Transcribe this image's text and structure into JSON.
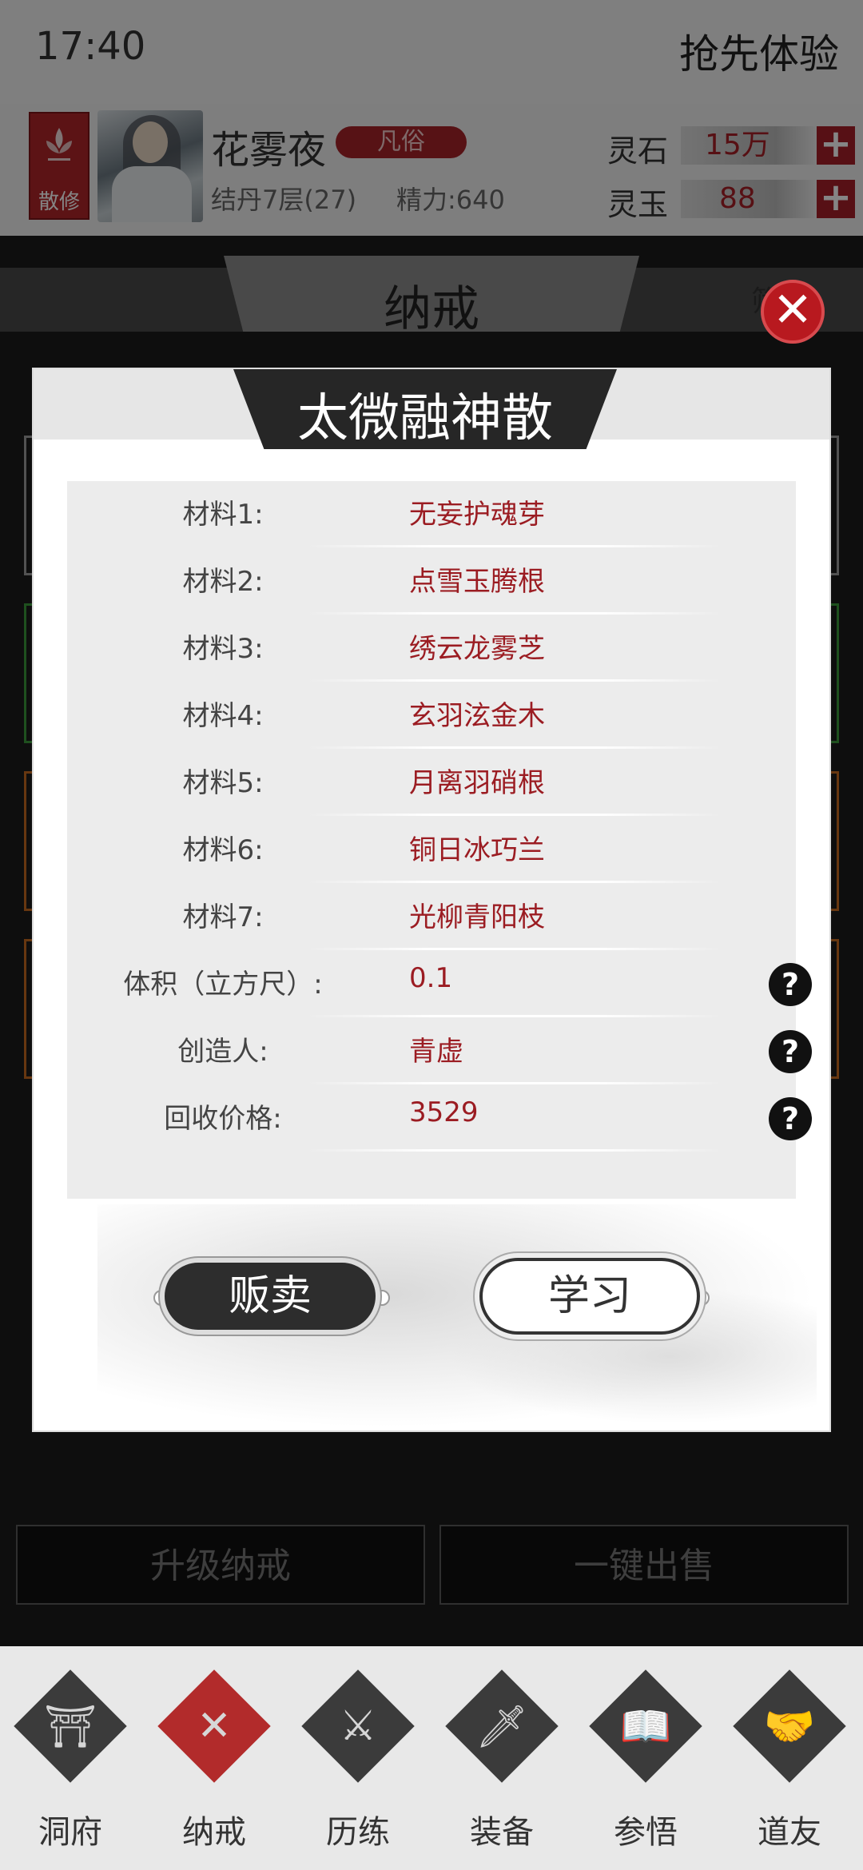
{
  "status": {
    "time": "17:40",
    "promo": "抢先体验"
  },
  "player": {
    "sect": "散修",
    "name": "花雾夜",
    "rank": "凡俗",
    "realm": "结丹7层(27)",
    "energy": "精力:640",
    "spirit_stone_label": "灵石",
    "spirit_stone_value": "15万",
    "spirit_jade_label": "灵玉",
    "spirit_jade_value": "88"
  },
  "background": {
    "tab_title": "纳戒",
    "filter": "筛",
    "upgrade_button": "升级纳戒",
    "sell_all_button": "一键出售"
  },
  "dialog": {
    "title": "太微融神散",
    "rows": [
      {
        "label": "材料1:",
        "value": "无妄护魂芽"
      },
      {
        "label": "材料2:",
        "value": "点雪玉腾根"
      },
      {
        "label": "材料3:",
        "value": "绣云龙雾芝"
      },
      {
        "label": "材料4:",
        "value": "玄羽泫金木"
      },
      {
        "label": "材料5:",
        "value": "月离羽硝根"
      },
      {
        "label": "材料6:",
        "value": "铜日冰巧兰"
      },
      {
        "label": "材料7:",
        "value": "光柳青阳枝"
      },
      {
        "label": "体积（立方尺）:",
        "value": "0.1"
      },
      {
        "label": "创造人:",
        "value": "青虚"
      },
      {
        "label": "回收价格:",
        "value": "3529"
      }
    ],
    "help_glyph": "?",
    "sell_button": "贩卖",
    "learn_button": "学习",
    "close_glyph": "✕"
  },
  "nav": [
    {
      "label": "洞府",
      "icon": "cave-gate-icon",
      "glyph": "⛩"
    },
    {
      "label": "纳戒",
      "icon": "ring-storage-icon",
      "glyph": "✕"
    },
    {
      "label": "历练",
      "icon": "crossed-swords-icon",
      "glyph": "⚔"
    },
    {
      "label": "装备",
      "icon": "sword-equipment-icon",
      "glyph": "🗡"
    },
    {
      "label": "参悟",
      "icon": "book-meditation-icon",
      "glyph": "📖"
    },
    {
      "label": "道友",
      "icon": "handshake-icon",
      "glyph": "🤝"
    }
  ],
  "colors": {
    "accent": "#a8232a",
    "dark": "#262626",
    "value_text": "#9b1c22"
  }
}
